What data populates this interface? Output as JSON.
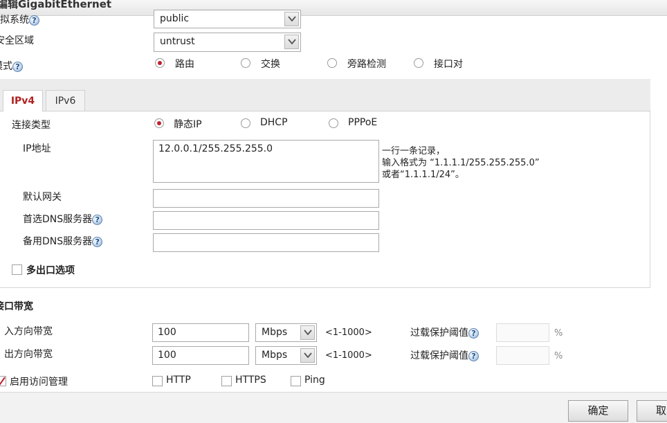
{
  "window": {
    "title": "编辑GigabitEthernet"
  },
  "top": {
    "row1_label": "虚拟系统",
    "row1_value": "public",
    "zone_label": "安全区域",
    "zone_value": "untrust",
    "mode_label": "模式",
    "mode_options": [
      "路由",
      "交换",
      "旁路检测",
      "接口对"
    ],
    "mode_selected": "路由"
  },
  "tabs": [
    {
      "label": "IPv4"
    },
    {
      "label": "IPv6"
    }
  ],
  "ipv4": {
    "conn_type_label": "连接类型",
    "conn_options": [
      "静态IP",
      "DHCP",
      "PPPoE"
    ],
    "ip_label": "IP地址",
    "ip_value": "12.0.0.1/255.255.255.0",
    "hint1": "一行一条记录，",
    "hint2": "输入格式为 “1.1.1.1/255.255.255.0”",
    "hint3": "或者“1.1.1.1/24”。",
    "gateway_label": "默认网关",
    "gateway_value": "",
    "dns1_label": "首选DNS服务器",
    "dns1_value": "",
    "dns2_label": "备用DNS服务器",
    "dns2_value": "",
    "multi_exit_label": "多出口选项"
  },
  "bandwidth": {
    "section_title": "接口带宽",
    "in_label": "入方向带宽",
    "in_value": "100",
    "in_unit": "Mbps",
    "out_label": "出方向带宽",
    "out_value": "100",
    "out_unit": "Mbps",
    "range": "<1-1000>",
    "overload_label": "过载保护阈值",
    "percent": "%"
  },
  "access": {
    "label": "启用访问管理",
    "options": [
      "HTTP",
      "HTTPS",
      "Ping"
    ]
  },
  "footer": {
    "ok": "确定",
    "cancel": "取消"
  },
  "colors": {
    "accent": "#c0202f",
    "help_icon": "#5f86b3"
  },
  "icons": {
    "help": "help-icon",
    "dropdown": "chevron-down-icon",
    "checkmark": "checkmark-icon"
  }
}
